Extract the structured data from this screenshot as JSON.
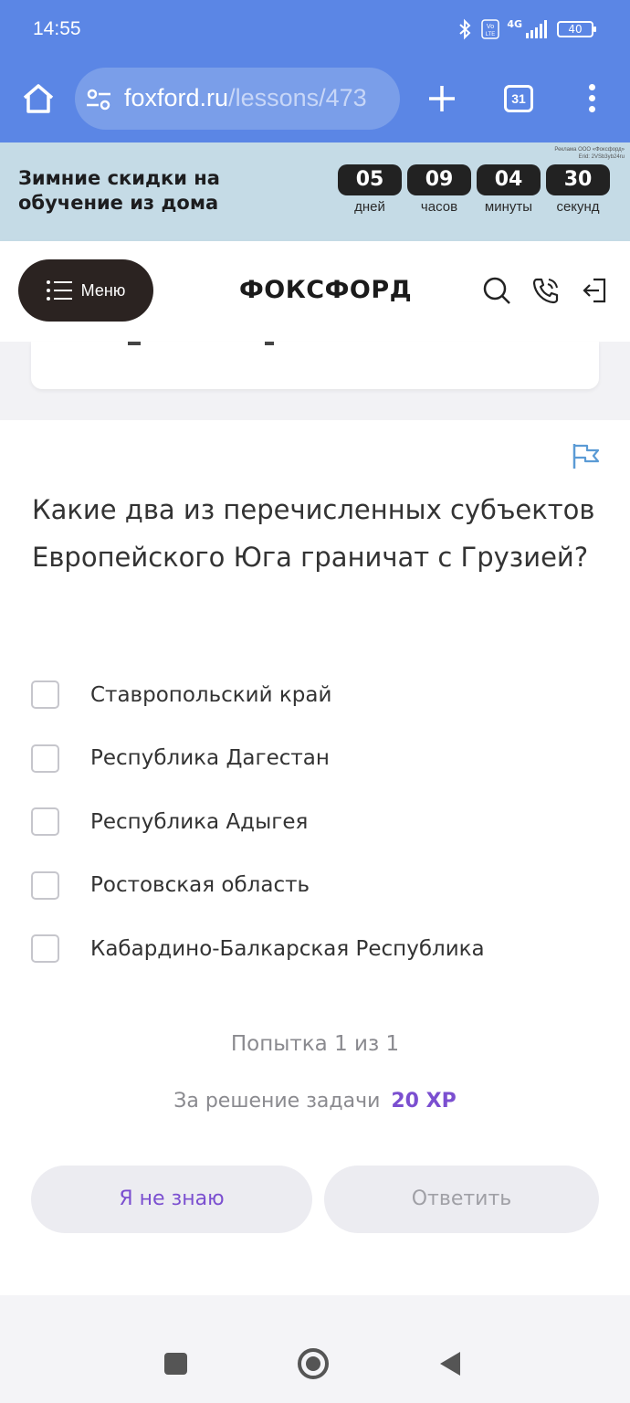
{
  "status_bar": {
    "time": "14:55",
    "network": "4G",
    "volte": "Vo LTE",
    "battery": "40"
  },
  "browser": {
    "url_domain": "foxford.ru",
    "url_path": "/lessons/473",
    "tab_count": "31"
  },
  "promo": {
    "headline": "Зимние скидки на обучение из дома",
    "ad_note_line1": "Реклама ООО «Фоксфорд»",
    "ad_note_line2": "Erid: 2VSb3yb24ru",
    "countdown": [
      {
        "value": "05",
        "label": "дней"
      },
      {
        "value": "09",
        "label": "часов"
      },
      {
        "value": "04",
        "label": "минуты"
      },
      {
        "value": "30",
        "label": "секунд"
      }
    ]
  },
  "site_header": {
    "menu_label": "Меню",
    "logo": "ФОКСФОРД"
  },
  "task": {
    "question": "Какие два из перечисленных субъектов Европейского Юга граничат с Грузией?",
    "options": [
      "Ставропольский край",
      "Республика Дагестан",
      "Республика Адыгея",
      "Ростовская область",
      "Кабардино-Балкарская Республика"
    ],
    "attempt": "Попытка 1 из 1",
    "reward_label": "За решение задачи",
    "reward_value": "20 XP",
    "dont_know_label": "Я не знаю",
    "answer_label": "Ответить"
  },
  "colors": {
    "browser_blue": "#5b86e5",
    "promo_bg": "#c5dbe6",
    "accent_purple": "#7b4fd0",
    "dark": "#2b2321"
  }
}
